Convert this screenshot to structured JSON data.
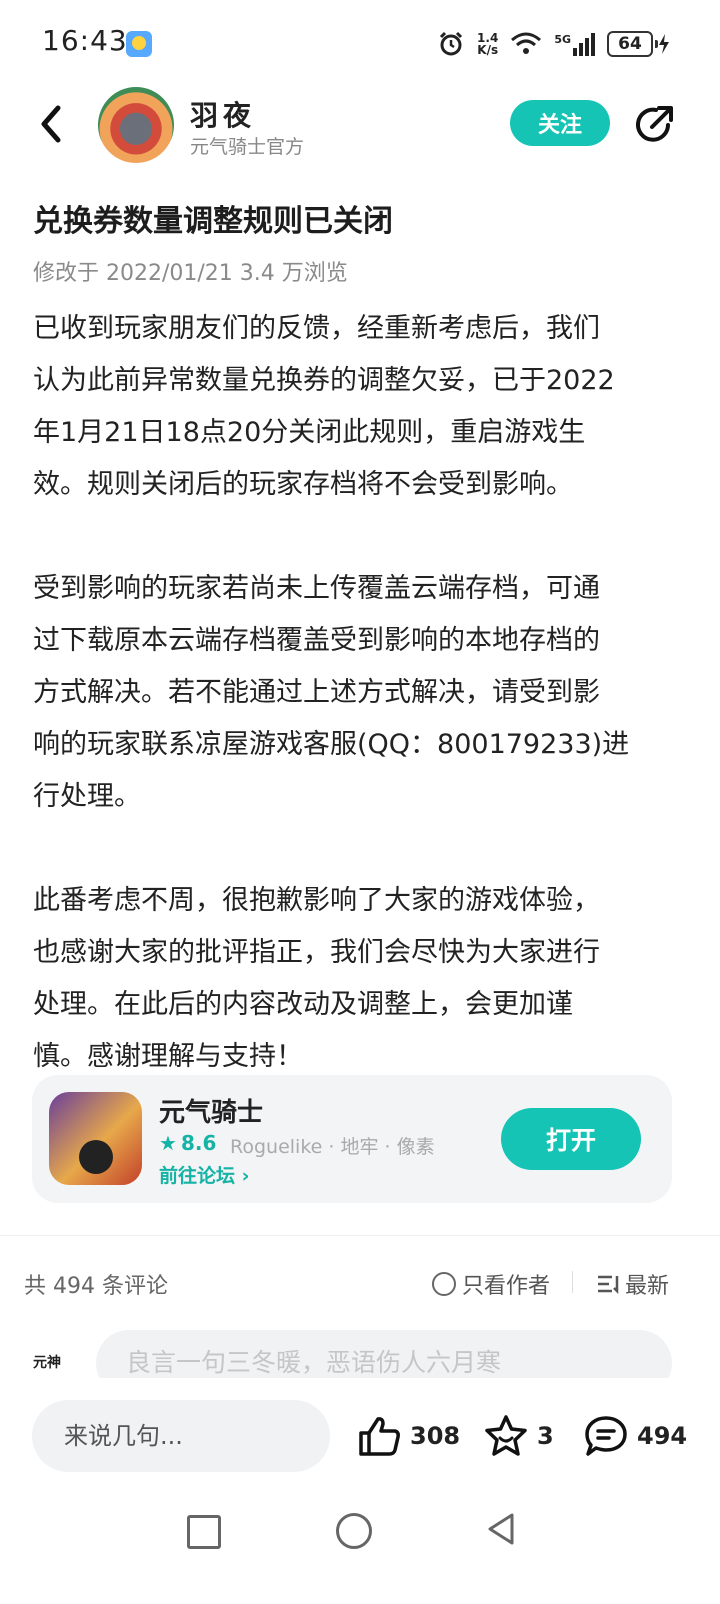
{
  "status": {
    "time": "16:43",
    "net_speed_top": "1.4",
    "net_speed_bottom": "K/s",
    "signal_label": "5G",
    "battery": "64"
  },
  "header": {
    "author_name": "羽夜",
    "author_subtitle": "元气骑士官方",
    "follow_label": "关注"
  },
  "article": {
    "title": "兑换券数量调整规则已关闭",
    "meta": "修改于 2022/01/21  3.4 万浏览",
    "paragraphs": [
      "已收到玩家朋友们的反馈，经重新考虑后，我们\n认为此前异常数量兑换券的调整欠妥，已于2022\n年1月21日18点20分关闭此规则，重启游戏生\n效。规则关闭后的玩家存档将不会受到影响。",
      "受到影响的玩家若尚未上传覆盖云端存档，可通\n过下载原本云端存档覆盖受到影响的本地存档的\n方式解决。若不能通过上述方式解决，请受到影\n响的玩家联系凉屋游戏客服(QQ：800179233)进\n行处理。",
      "此番考虑不周，很抱歉影响了大家的游戏体验，\n也感谢大家的批评指正，我们会尽快为大家进行\n处理。在此后的内容改动及调整上，会更加谨\n慎。感谢理解与支持！"
    ]
  },
  "app_card": {
    "name": "元气骑士",
    "rating": "8.6",
    "tags": "Roguelike · 地牢 · 像素",
    "forum_link": "前往论坛",
    "open_label": "打开"
  },
  "comments": {
    "count_text": "共 494 条评论",
    "author_only": "只看作者",
    "sort_label": "最新",
    "placeholder": "良言一句三冬暖，恶语伤人六月寒",
    "logo_text": "元神"
  },
  "bottom_bar": {
    "input_placeholder": "来说几句...",
    "likes": "308",
    "favorites": "3",
    "comments": "494"
  },
  "colors": {
    "accent": "#15c4b5"
  }
}
